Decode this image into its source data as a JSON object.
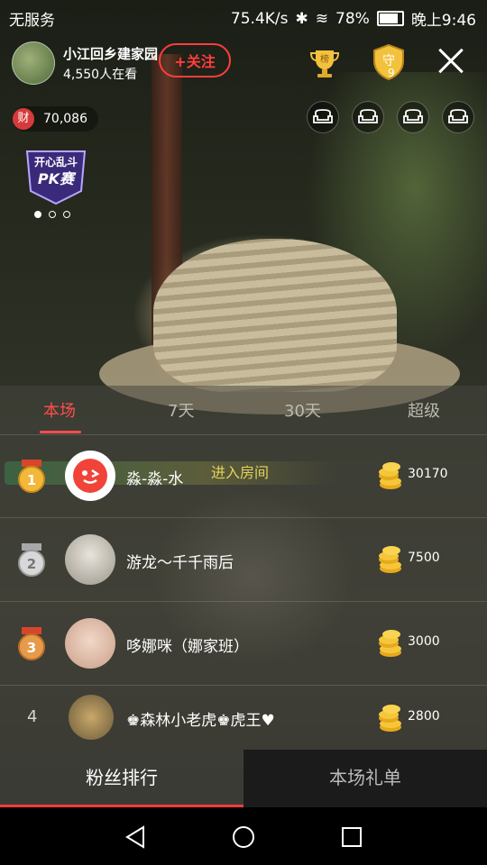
{
  "status_bar": {
    "carrier": "无服务",
    "network_speed": "75.4K/s",
    "battery": "78%",
    "time": "晚上9:46"
  },
  "host": {
    "name": "小江回乡建家园",
    "viewers": "4,550人在看",
    "follow_label": "+关注"
  },
  "top_icons": {
    "trophy_label": "榜",
    "guard_label": "守",
    "guard_count": "9"
  },
  "wealth": {
    "icon_label": "财",
    "value": "70,086"
  },
  "pk_banner": {
    "line1": "开心乱斗",
    "line2": "PK赛"
  },
  "panel": {
    "tabs": [
      {
        "label": "本场",
        "active": true
      },
      {
        "label": "7天",
        "active": false
      },
      {
        "label": "30天",
        "active": false
      },
      {
        "label": "超级",
        "active": false
      }
    ],
    "entry_notice": "进入房间",
    "ranking": [
      {
        "rank": "1",
        "name": "淼-淼-水",
        "score": "30170"
      },
      {
        "rank": "2",
        "name": "游龙～千千雨后",
        "score": "7500"
      },
      {
        "rank": "3",
        "name": "哆娜咪（娜家班）",
        "score": "3000"
      },
      {
        "rank": "4",
        "name": "♚森林小老虎♚虎王♥",
        "score": "2800"
      }
    ]
  },
  "bottom_tabs": {
    "fans_rank": "粉丝排行",
    "gift_list": "本场礼单"
  },
  "colors": {
    "accent_red": "#ff3d3d",
    "gold": "#f3c23c"
  }
}
